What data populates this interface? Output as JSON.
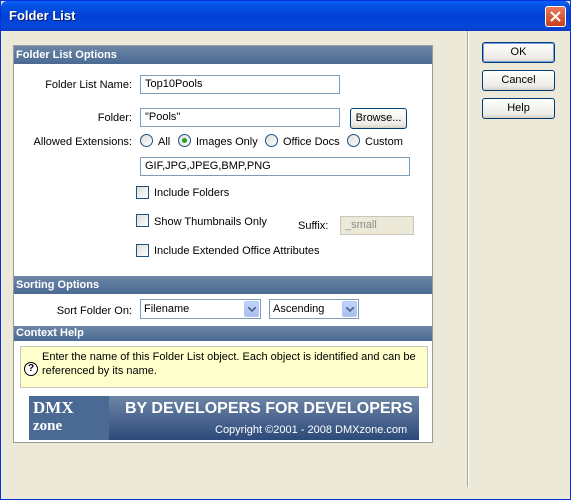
{
  "window": {
    "title": "Folder List"
  },
  "dialog_buttons": {
    "ok": "OK",
    "cancel": "Cancel",
    "help": "Help"
  },
  "options": {
    "header": "Folder List Options",
    "name_label": "Folder List Name:",
    "name_value": "Top10Pools",
    "folder_label": "Folder:",
    "folder_value": "\"Pools\"",
    "browse": "Browse...",
    "ext_label": "Allowed Extensions:",
    "ext_choices": [
      "All",
      "Images Only",
      "Office Docs",
      "Custom"
    ],
    "ext_selected": "Images Only",
    "ext_value": "GIF,JPG,JPEG,BMP,PNG",
    "include_folders": "Include Folders",
    "show_thumbnails": "Show Thumbnails Only",
    "suffix_label": "Suffix:",
    "suffix_value": "_small",
    "include_office_attrs": "Include Extended Office Attributes"
  },
  "sorting": {
    "header": "Sorting Options",
    "label": "Sort Folder On:",
    "field": "Filename",
    "order": "Ascending"
  },
  "context_help": {
    "header": "Context Help",
    "text": "Enter the name of this Folder List object. Each object is identified and can be referenced by its name."
  },
  "banner": {
    "logo_line1": "DMX",
    "logo_line2": "zone",
    "title": "BY DEVELOPERS FOR DEVELOPERS",
    "copyright": "Copyright ©2001 - 2008 DMXzone.com"
  },
  "colors": {
    "titlebar": "#0452e4",
    "section_header": "#5a769c",
    "radio_selected": "#21a121",
    "help_bg": "#ffffcc"
  }
}
